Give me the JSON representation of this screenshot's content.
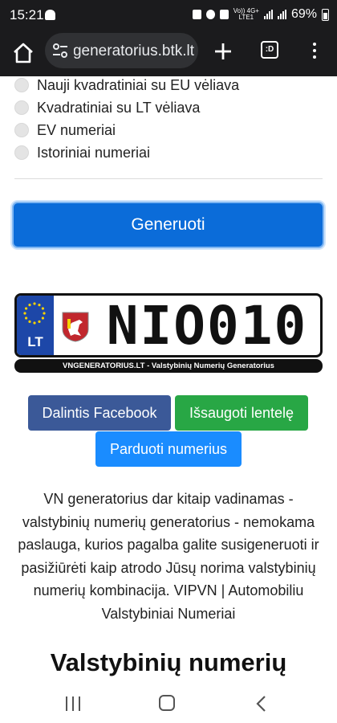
{
  "status_bar": {
    "time": "15:21",
    "network_top": "Vo)) 4G+",
    "network_bottom": "LTE1",
    "battery": "69%"
  },
  "browser": {
    "url": "vngeneratorius.btk.lt",
    "tabs_badge": ":D"
  },
  "options": [
    {
      "label": "Nauji kvadratiniai su EU vėliava"
    },
    {
      "label": "Kvadratiniai su LT vėliava"
    },
    {
      "label": "EV numeriai"
    },
    {
      "label": "Istoriniai numeriai"
    }
  ],
  "generate_label": "Generuoti",
  "plate": {
    "country": "LT",
    "number": "NIO010",
    "caption": "VNGENERATORIUS.LT - Valstybinių Numerių Generatorius"
  },
  "actions": {
    "facebook": "Dalintis Facebook",
    "save": "Išsaugoti lentelę",
    "sell": "Parduoti numerius"
  },
  "description": "VN generatorius dar kitaip vadinamas - valstybinių numerių generatorius - nemokama paslauga, kurios pagalba galite susigeneruoti ir pasižiūrėti kaip atrodo Jūsų norima valstybinių numerių kombinacija. VIPVN | Automobiliu Valstybiniai Numeriai",
  "section_heading": "Valstybinių numerių",
  "colors": {
    "primary": "#0b6cd9",
    "facebook": "#3b5998",
    "success": "#28a745",
    "info": "#1a8cff",
    "eu_blue": "#1d47a8"
  }
}
